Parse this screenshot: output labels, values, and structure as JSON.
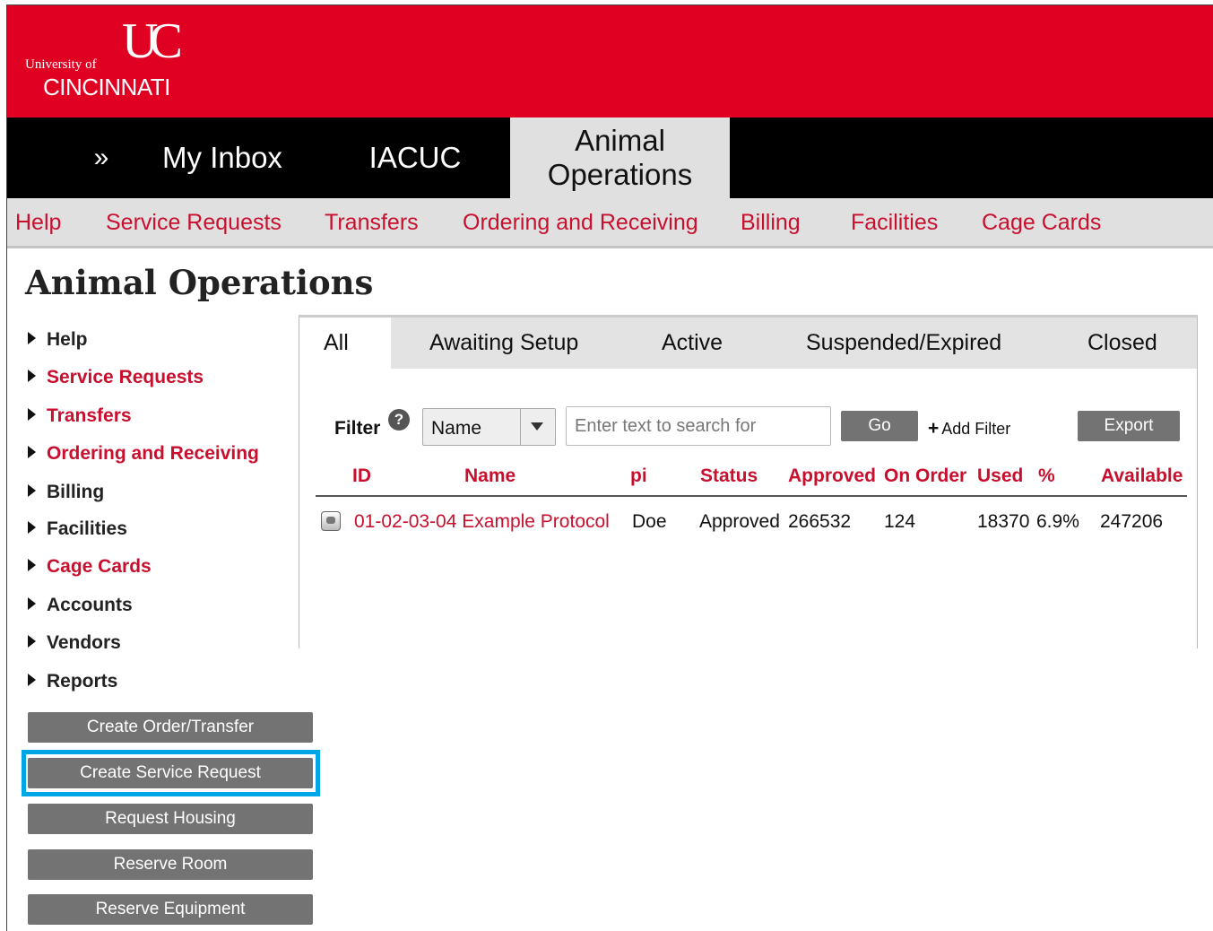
{
  "brand": {
    "logo_mark": "UC",
    "line1": "University of",
    "line2": "CINCINNATI",
    "color": "#e00122"
  },
  "main_nav": {
    "expand_label": "»",
    "inbox_label": "My Inbox",
    "iacuc_label": "IACUC",
    "animal_ops_line1": "Animal",
    "animal_ops_line2": "Operations"
  },
  "sub_nav": {
    "help": "Help",
    "service_requests": "Service Requests",
    "transfers": "Transfers",
    "ordering": "Ordering and Receiving",
    "billing": "Billing",
    "facilities": "Facilities",
    "cage_cards": "Cage Cards"
  },
  "page_title": "Animal Operations",
  "sidebar": {
    "items": [
      {
        "label": "Help"
      },
      {
        "label": "Service Requests"
      },
      {
        "label": "Transfers"
      },
      {
        "label": "Ordering and Receiving"
      },
      {
        "label": "Billing"
      },
      {
        "label": "Facilities"
      },
      {
        "label": "Cage Cards"
      },
      {
        "label": "Accounts"
      },
      {
        "label": "Vendors"
      },
      {
        "label": "Reports"
      }
    ],
    "buttons": {
      "create_order": "Create Order/Transfer",
      "create_service": "Create Service Request",
      "request_housing": "Request Housing",
      "reserve_room": "Reserve Room",
      "reserve_equipment": "Reserve Equipment"
    },
    "highlight_color": "#00a5e6"
  },
  "tabs": {
    "all": "All",
    "awaiting": "Awaiting Setup",
    "active": "Active",
    "suspended": "Suspended/Expired",
    "closed": "Closed"
  },
  "filter": {
    "label": "Filter",
    "help_icon": "?",
    "field_value": "Name",
    "search_placeholder": "Enter text to search for",
    "go_label": "Go",
    "add_filter_plus": "+",
    "add_filter_label": "Add Filter",
    "export_label": "Export"
  },
  "table": {
    "headers": {
      "id": "ID",
      "name": "Name",
      "pi": "pi",
      "status": "Status",
      "approved": "Approved",
      "on_order": "On Order",
      "used": "Used",
      "pct": "%",
      "available": "Available"
    },
    "rows": [
      {
        "id": "01-02-03-04",
        "name": "Example Protocol",
        "pi": "Doe",
        "status": "Approved",
        "approved": "266532",
        "on_order": "124",
        "used": "18370",
        "pct": "6.9%",
        "available": "247206"
      }
    ]
  },
  "colors": {
    "link_red": "#c8102e",
    "button_gray": "#737373"
  }
}
